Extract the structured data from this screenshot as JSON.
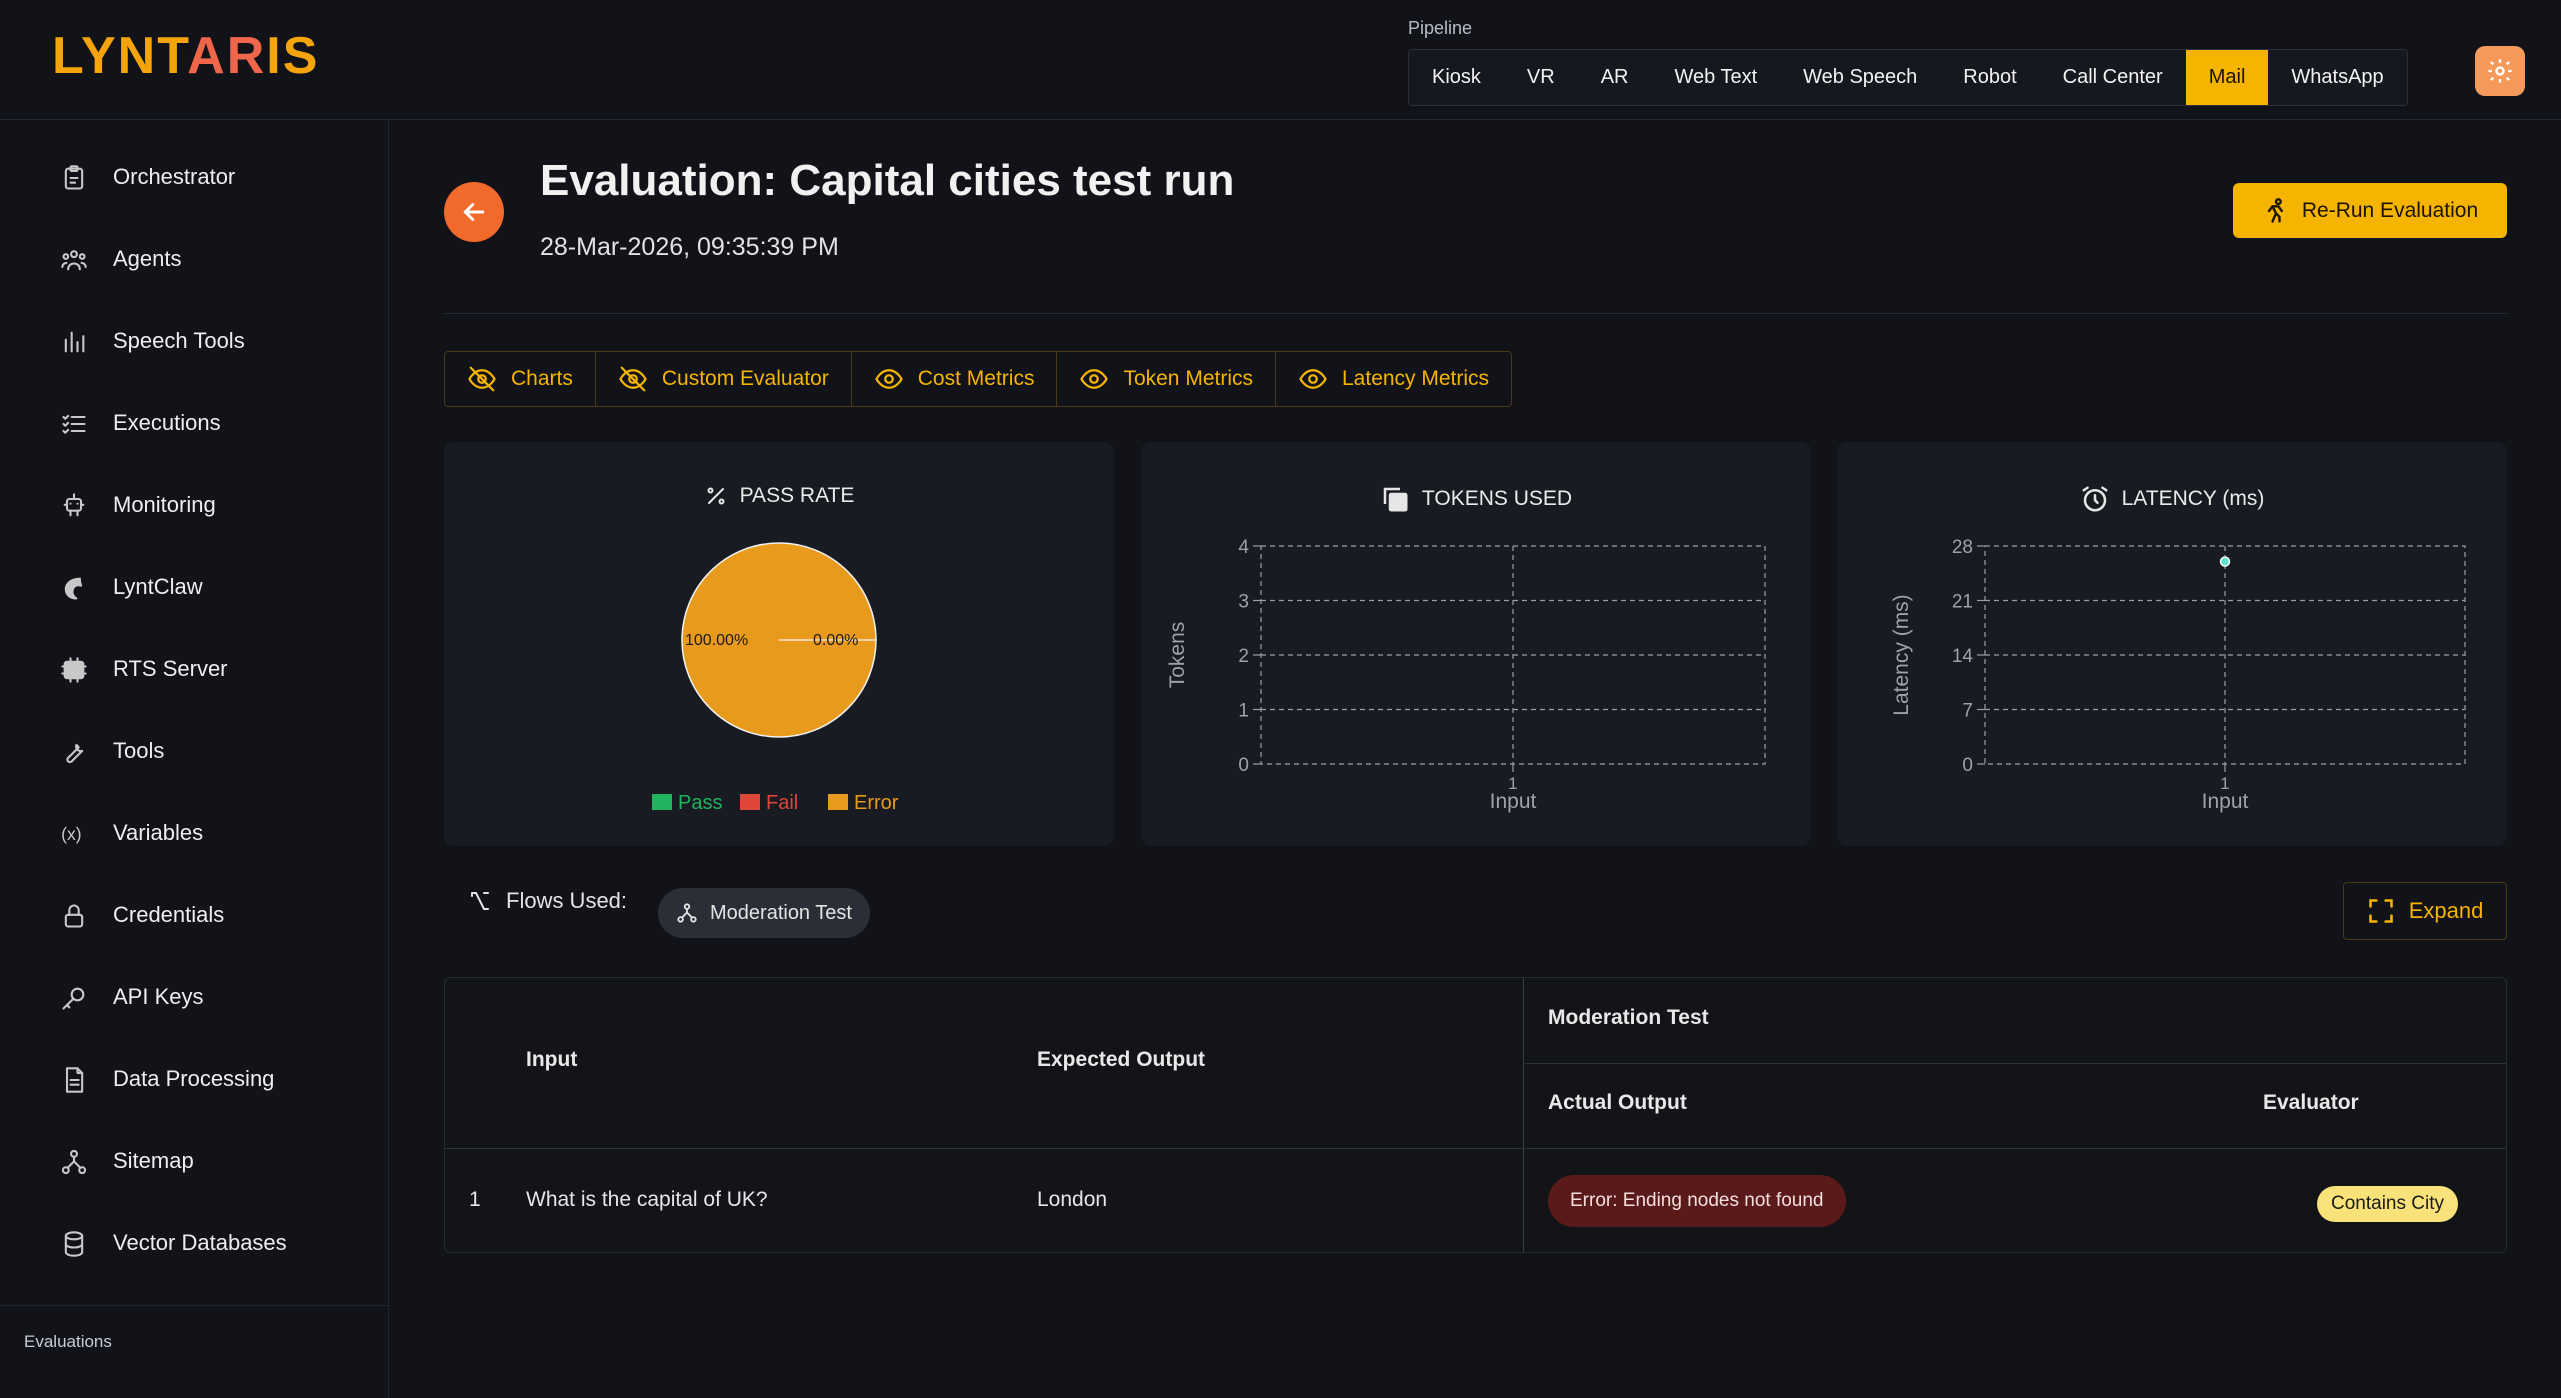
{
  "app": {
    "logo": "LYNTARIS"
  },
  "pipeline": {
    "label": "Pipeline",
    "tabs": [
      "Kiosk",
      "VR",
      "AR",
      "Web Text",
      "Web Speech",
      "Robot",
      "Call Center",
      "Mail",
      "WhatsApp"
    ],
    "active": "Mail"
  },
  "sidebar": {
    "items": [
      {
        "label": "Orchestrator",
        "icon": "clipboard-icon"
      },
      {
        "label": "Agents",
        "icon": "users-icon"
      },
      {
        "label": "Speech Tools",
        "icon": "bar-chart-icon"
      },
      {
        "label": "Executions",
        "icon": "list-checks-icon"
      },
      {
        "label": "Monitoring",
        "icon": "robot-icon"
      },
      {
        "label": "LyntClaw",
        "icon": "claw-icon"
      },
      {
        "label": "RTS Server",
        "icon": "server-icon"
      },
      {
        "label": "Tools",
        "icon": "wrench-icon"
      },
      {
        "label": "Variables",
        "icon": "variable-icon"
      },
      {
        "label": "Credentials",
        "icon": "lock-icon"
      },
      {
        "label": "API Keys",
        "icon": "key-icon"
      },
      {
        "label": "Data Processing",
        "icon": "document-icon"
      },
      {
        "label": "Sitemap",
        "icon": "sitemap-icon"
      },
      {
        "label": "Vector Databases",
        "icon": "database-icon"
      }
    ],
    "section_label": "Evaluations"
  },
  "page": {
    "title": "Evaluation: Capital cities test run",
    "date": "28-Mar-2026, 09:35:39 PM",
    "rerun_label": "Re-Run Evaluation"
  },
  "toggles": [
    {
      "label": "Charts",
      "icon": "eye-off-icon"
    },
    {
      "label": "Custom Evaluator",
      "icon": "eye-off-icon"
    },
    {
      "label": "Cost Metrics",
      "icon": "eye-icon"
    },
    {
      "label": "Token Metrics",
      "icon": "eye-icon"
    },
    {
      "label": "Latency Metrics",
      "icon": "eye-icon"
    }
  ],
  "colors": {
    "accent": "#f5b400",
    "pass": "#22b35e",
    "fail": "#e0463a",
    "error": "#e89a1c"
  },
  "chart_data": [
    {
      "type": "pie",
      "title": "PASS RATE",
      "labels": [
        "Pass",
        "Fail",
        "Error"
      ],
      "values": [
        0,
        0,
        100
      ],
      "slice_labels": [
        "100.00%",
        "0.00%"
      ],
      "legend": "bottom"
    },
    {
      "type": "line",
      "title": "TOKENS USED",
      "categories": [
        "1"
      ],
      "xlabel": "Input",
      "ylabel": "Tokens",
      "ylim": [
        0,
        4
      ],
      "yticks": [
        0,
        1,
        2,
        3,
        4
      ],
      "series": [
        {
          "values": []
        }
      ],
      "grid": true
    },
    {
      "type": "line",
      "title": "LATENCY (ms)",
      "categories": [
        "1"
      ],
      "xlabel": "Input",
      "ylabel": "Latency (ms)",
      "ylim": [
        0,
        28
      ],
      "yticks": [
        0,
        7,
        14,
        21,
        28
      ],
      "series": [
        {
          "values": [
            26
          ]
        }
      ],
      "grid": true
    }
  ],
  "flows": {
    "label": "Flows Used:",
    "chip": "Moderation Test",
    "expand_label": "Expand"
  },
  "table": {
    "headers": {
      "input": "Input",
      "expected": "Expected Output",
      "group": "Moderation Test",
      "actual": "Actual Output",
      "evaluator": "Evaluator"
    },
    "rows": [
      {
        "index": "1",
        "input": "What is the capital of UK?",
        "expected": "London",
        "actual": "Error: Ending nodes not found",
        "evaluator": "Contains City"
      }
    ]
  }
}
